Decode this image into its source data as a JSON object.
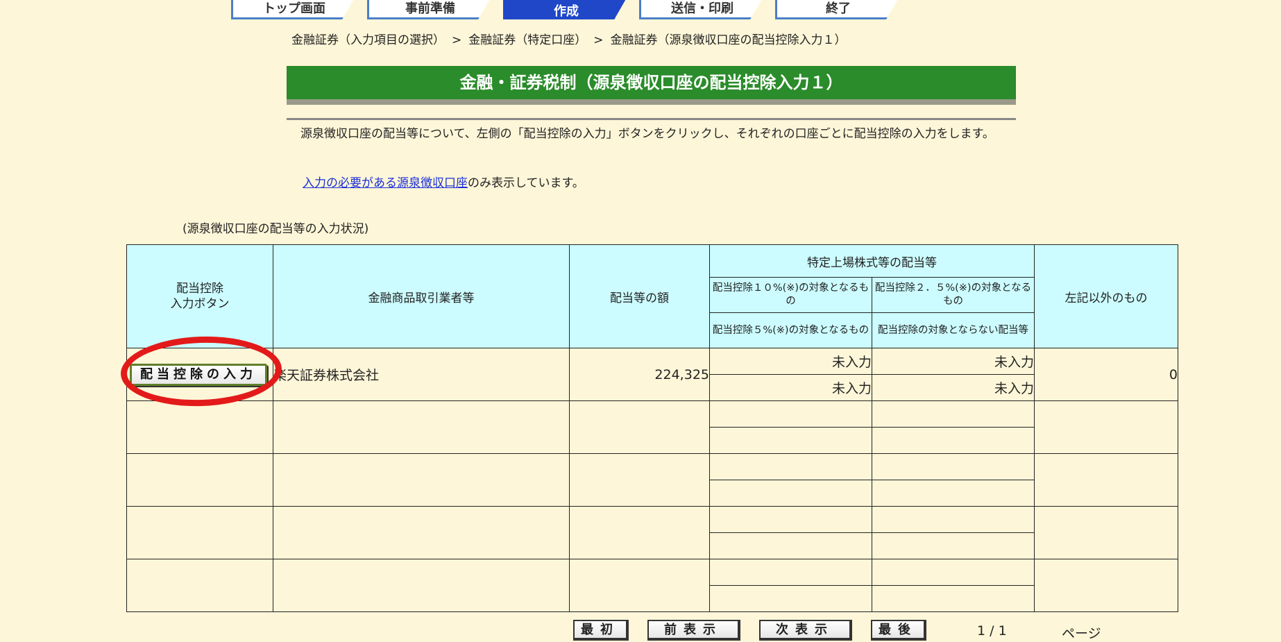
{
  "steps": [
    "トップ画面",
    "事前準備",
    "作成",
    "送信・印刷",
    "終了"
  ],
  "breadcrumb": [
    "金融証券（入力項目の選択）",
    "金融証券（特定口座）",
    "金融証券（源泉徴収口座の配当控除入力１）"
  ],
  "breadcrumb_sep": ">",
  "title": "金融・証券税制（源泉徴収口座の配当控除入力１）",
  "description": "　源泉徴収口座の配当等について、左側の「配当控除の入力」ボタンをクリックし、それぞれの口座ごとに配当控除の入力をします。",
  "note": {
    "link": "入力の必要がある源泉徴収口座",
    "text": "のみ表示しています。"
  },
  "caption": "(源泉徴収口座の配当等の入力状況)",
  "table": {
    "headers": {
      "button_col": "配当控除\n入力ボタン",
      "broker": "金融商品取引業者等",
      "amount": "配当等の額",
      "group": "特定上場株式等の配当等",
      "sub10": "配当控除１０%(※)の対象となるもの",
      "sub25": "配当控除２．５%(※)の対象となるもの",
      "sub5": "配当控除５%(※)の対象となるもの",
      "subnone": "配当控除の対象とならない配当等",
      "other": "左記以外のもの"
    },
    "rows": [
      {
        "button": "配当控除の入力",
        "broker": "楽天証券株式会社",
        "amount": "224,325",
        "c10": "未入力",
        "c25": "未入力",
        "c5": "未入力",
        "cnone": "未入力",
        "other": "0"
      },
      {
        "button": "",
        "broker": "",
        "amount": "",
        "c10": "",
        "c25": "",
        "c5": "",
        "cnone": "",
        "other": ""
      },
      {
        "button": "",
        "broker": "",
        "amount": "",
        "c10": "",
        "c25": "",
        "c5": "",
        "cnone": "",
        "other": ""
      },
      {
        "button": "",
        "broker": "",
        "amount": "",
        "c10": "",
        "c25": "",
        "c5": "",
        "cnone": "",
        "other": ""
      },
      {
        "button": "",
        "broker": "",
        "amount": "",
        "c10": "",
        "c25": "",
        "c5": "",
        "cnone": "",
        "other": ""
      }
    ]
  },
  "pager": {
    "first": "最初",
    "prev": "前表示",
    "next": "次表示",
    "last": "最後",
    "page_info": "1 / 1",
    "page_label": "ページ"
  }
}
